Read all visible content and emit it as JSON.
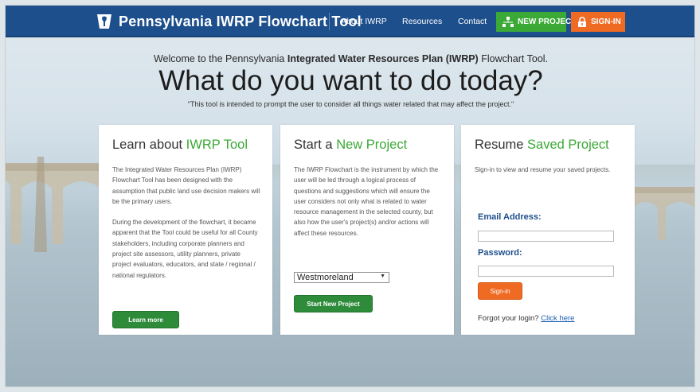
{
  "header": {
    "title": "Pennsylvania IWRP Flowchart Tool",
    "nav": [
      "About IWRP",
      "Resources",
      "Contact"
    ],
    "new_project": "NEW PROJECT",
    "sign_in": "SIGN-IN",
    "colors": {
      "bar": "#1d4f8c",
      "new_project": "#3aa935",
      "sign_in": "#ef6a23"
    }
  },
  "hero": {
    "welcome_pre": "Welcome to the Pennsylvania ",
    "welcome_bold": "Integrated Water Resources Plan (IWRP)",
    "welcome_post": " Flowchart Tool.",
    "headline": "What do you want to do today?",
    "subline": "\"This tool is intended to prompt the user to consider all things water related that may affect the project.\""
  },
  "cards": {
    "learn": {
      "title_pre": "Learn about ",
      "title_accent": "IWRP Tool",
      "p1": "The Integrated Water Resources Plan (IWRP) Flowchart Tool has been designed with the assumption that public land use decision makers will be the primary users.",
      "p2": "During the development of the flowchart, it became apparent that the Tool could be useful for all County stakeholders, including corporate planners and project site assessors, utility planners, private project evaluators, educators, and state / regional / national regulators.",
      "button": "Learn more"
    },
    "start": {
      "title_pre": "Start a ",
      "title_accent": "New Project",
      "p1": "The IWRP Flowchart is the instrument by which the user will be led through a logical process of questions and suggestions which will ensure the user considers not only what is related to water resource management in the selected county, but also how the user's project(s) and/or actions will affect these resources.",
      "county_selected": "Westmoreland",
      "button": "Start New Project"
    },
    "resume": {
      "title_pre": "Resume ",
      "title_accent": "Saved Project",
      "p1": "Sign-in to view and resume your saved projects.",
      "email_label": "Email Address:",
      "password_label": "Password:",
      "email_value": "",
      "password_value": "",
      "button": "Sign-in",
      "forgot_text": "Forgot your login?",
      "forgot_link": "Click here"
    }
  }
}
